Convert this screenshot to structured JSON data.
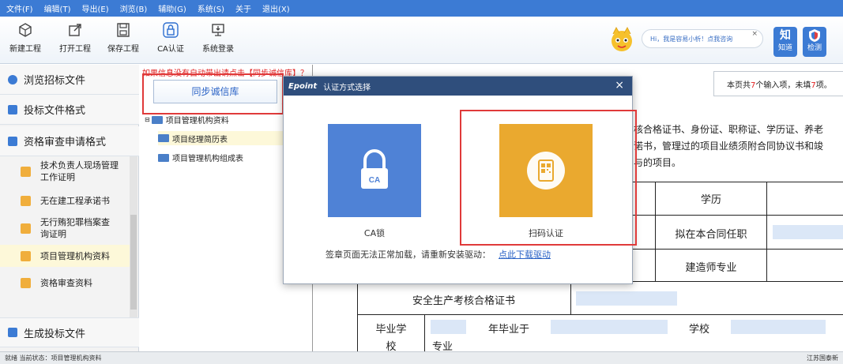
{
  "menu": [
    "文件(F)",
    "编辑(T)",
    "导出(E)",
    "浏览(B)",
    "辅助(G)",
    "系统(S)",
    "关于",
    "退出(X)"
  ],
  "toolbar": {
    "new_project": "新建工程",
    "open_project": "打开工程",
    "save_project": "保存工程",
    "ca_auth": "CA认证",
    "system_login": "系统登录"
  },
  "assistant": {
    "bubble_text": "Hi，我是容易小析！点我咨询",
    "close": "×",
    "zhidao_big": "知",
    "zhidao_label": "知道",
    "jiance_label": "检测"
  },
  "sidebar": {
    "browse": "浏览招标文件",
    "format": "投标文件格式",
    "qual": "资格审查申请格式",
    "items": [
      "技术负责人现场管理工作证明",
      "无在建工程承诺书",
      "无行贿犯罪档案查询证明",
      "项目管理机构资料",
      "资格审查资料"
    ],
    "generate": "生成投标文件"
  },
  "left_panel": {
    "red_note": "如果信息没有自动带出请点击【同步诚信库】？",
    "sync_button": "同步诚信库",
    "tree_root": "项目管理机构资料",
    "tree_items": [
      "项目经理简历表",
      "项目管理机构组成表"
    ]
  },
  "document": {
    "notice_pre": "本页共",
    "notice_n1": "7",
    "notice_mid": "个输入项，未填",
    "notice_n2": "7",
    "notice_post": "项。",
    "line1": "核合格证书、身份证、职称证、学历证、养老",
    "line2": "诺书，管理过的项目业绩须附合同协议书和竣",
    "line3": "与的项目。",
    "cell_xueli": "学历",
    "cell_niren": "拟在本合同任职",
    "cell_jianzao": "建造师专业",
    "cell_anquan": "安全生产考核合格证书",
    "cell_biye1": "毕业学",
    "cell_biye2": "校",
    "cell_nian": "年毕业于",
    "cell_xuexiao": "学校",
    "cell_zhuanye": "专业"
  },
  "modal": {
    "logo": "Epoint",
    "title": "认证方式选择",
    "close": "×",
    "ca_label": "CA锁",
    "ca_badge": "CA",
    "scan_label": "扫码认证",
    "footer": "签章页面无法正常加载，请重新安装驱动：",
    "footer_link": "点此下载驱动"
  },
  "status": {
    "left": "就绪   当前状态：项目管理机构资料",
    "right": "江苏国泰新"
  },
  "colors": {
    "accent_blue": "#3c7bd4",
    "ca_blue": "#4f82d6",
    "scan_orange": "#eaa92f",
    "highlight_red": "#e03a3a"
  }
}
